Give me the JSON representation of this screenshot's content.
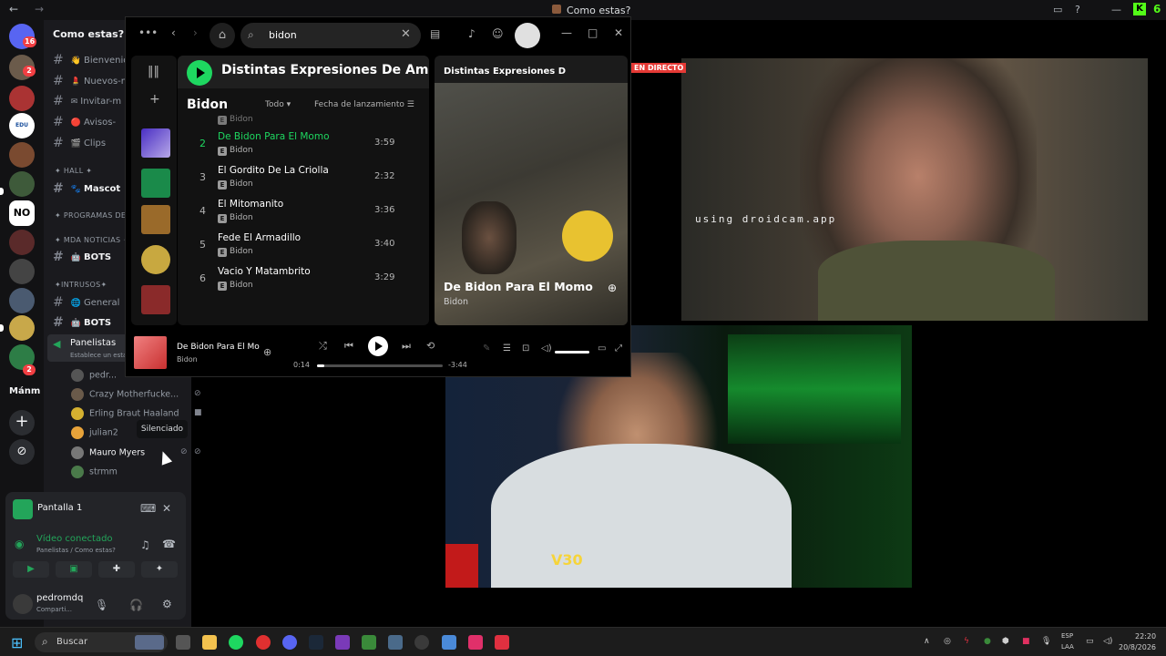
{
  "window": {
    "title": "Como estas?",
    "nav_back": "←",
    "nav_forward": "→"
  },
  "topbar_right": {
    "corner_number": "6"
  },
  "rail": {
    "badges": [
      "16",
      "2",
      "2"
    ],
    "server_no": "NO",
    "server_edu": "EDU",
    "server_man": "Mánm",
    "add_label": "+"
  },
  "sidebar": {
    "server_name": "Como estas?",
    "channels": [
      {
        "emoji": "👋",
        "name": "Bienvenid"
      },
      {
        "emoji": "💄",
        "name": "Nuevos-m"
      },
      {
        "emoji": "✉",
        "name": "Invitar-m"
      },
      {
        "emoji": "🔴",
        "name": "Avisos-"
      },
      {
        "emoji": "🎬",
        "name": "Clips"
      }
    ],
    "cat_hall": "✦ HALL ✦",
    "hall_channel": "Mascot",
    "cat_programas": "✦ PROGRAMAS DE C",
    "cat_mda": "✦ MDA NOTICIAS ✦",
    "mda_channel": "BOTS",
    "cat_intrusos": "✦INTRUSOS✦",
    "intrusos_general": "General",
    "intrusos_bots": "BOTS",
    "voice_channel": "Panelistas",
    "voice_status": "Establece un esta",
    "voice_users": [
      "pedr...",
      "Crazy Motherfucke...",
      "Erling Braut Haaland",
      "julian2",
      "Mauro Myers",
      "strmm"
    ],
    "tooltip": "Silenciado"
  },
  "screen_panel": {
    "title": "Pantalla 1",
    "video_status": "Vídeo conectado",
    "video_sub": "Panelistas / Como estas?",
    "user_name": "pedromdq",
    "user_status": "Comparti..."
  },
  "spotify": {
    "search_value": "bidon",
    "album_title": "Distintas Expresiones De Amor",
    "np_header": "Distintas Expresiones D",
    "artist": "Bidon",
    "filter": "Todo",
    "sort": "Fecha de lanzamiento",
    "partial_artist": "Bidon",
    "tracks": [
      {
        "num": "2",
        "title": "De Bidon Para El Momo",
        "artist": "Bidon",
        "duration": "3:59",
        "active": true
      },
      {
        "num": "3",
        "title": "El Gordito De La Criolla",
        "artist": "Bidon",
        "duration": "2:32"
      },
      {
        "num": "4",
        "title": "El Mitomanito",
        "artist": "Bidon",
        "duration": "3:36"
      },
      {
        "num": "5",
        "title": "Fede El Armadillo",
        "artist": "Bidon",
        "duration": "3:40"
      },
      {
        "num": "6",
        "title": "Vacio Y Matambrito",
        "artist": "Bidon",
        "duration": "3:29"
      }
    ],
    "explicit": "E",
    "np_title": "De Bidon Para El Momo",
    "np_artist": "Bidon",
    "player": {
      "title": "De Bidon Para El Mo",
      "artist": "Bidon",
      "elapsed": "0:14",
      "remaining": "-3:44",
      "progress_fraction": 0.06
    }
  },
  "live_badge": "EN DIRECTO",
  "cam1_overlay": "using droidcam.app",
  "cam2_overlay": "V30",
  "taskbar": {
    "search_placeholder": "Buscar",
    "lang_top": "ESP",
    "lang_bottom": "LAA",
    "time": "22:20",
    "date": "20/8/2026"
  },
  "colors": {
    "spotify_green": "#1ed760",
    "discord_green": "#23a55a",
    "live_red": "#e53935"
  }
}
